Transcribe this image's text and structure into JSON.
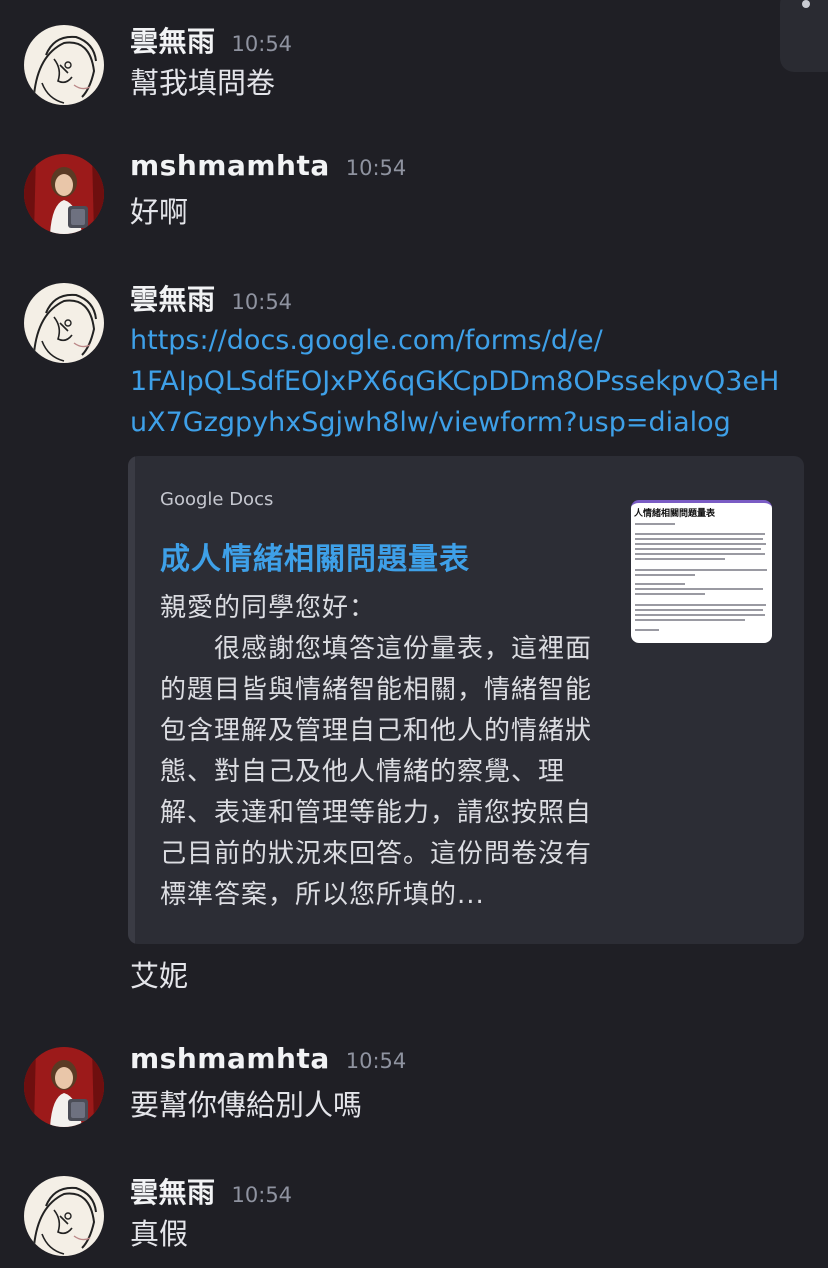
{
  "messages": [
    {
      "user": "雲無雨",
      "time": "10:54",
      "text": "幫我填問卷"
    },
    {
      "user": "mshmamhta",
      "time": "10:54",
      "text": "好啊"
    },
    {
      "user": "雲無雨",
      "time": "10:54",
      "link_lines": [
        "https://docs.google.com/forms/d/e/",
        "1FAIpQLSdfEOJxPX6qGKCpDDm8OPssekpvQ3eH",
        "uX7GzgpyhxSgjwh8lw/viewform?usp=dialog"
      ],
      "embed": {
        "provider": "Google Docs",
        "title": "成人情緒相關問題量表",
        "description_lines": [
          "親愛的同學您好：",
          "　　很感謝您填答這份量表，這裡面",
          "的題目皆與情緒智能相關，情緒智能",
          "包含理解及管理自己和他人的情緒狀",
          "態、對自己及他人情緒的察覺、理",
          "解、表達和管理等能力，請您按照自",
          "己目前的狀況來回答。這份問卷沒有",
          "標準答案，所以您所填的..."
        ],
        "thumbnail_title": "人情緒相關問題量表"
      },
      "followup": "艾妮"
    },
    {
      "user": "mshmamhta",
      "time": "10:54",
      "text": "要幫你傳給別人嗎"
    },
    {
      "user": "雲無雨",
      "time": "10:54",
      "text": "真假"
    }
  ],
  "icons": {
    "avatar_sketch": "sketch-avatar-icon",
    "avatar_photo": "photo-avatar-icon"
  },
  "colors": {
    "background": "#1f1f25",
    "link": "#3ea0e8",
    "embed_bg": "#2c2d35",
    "timestamp": "#8f93a0"
  }
}
